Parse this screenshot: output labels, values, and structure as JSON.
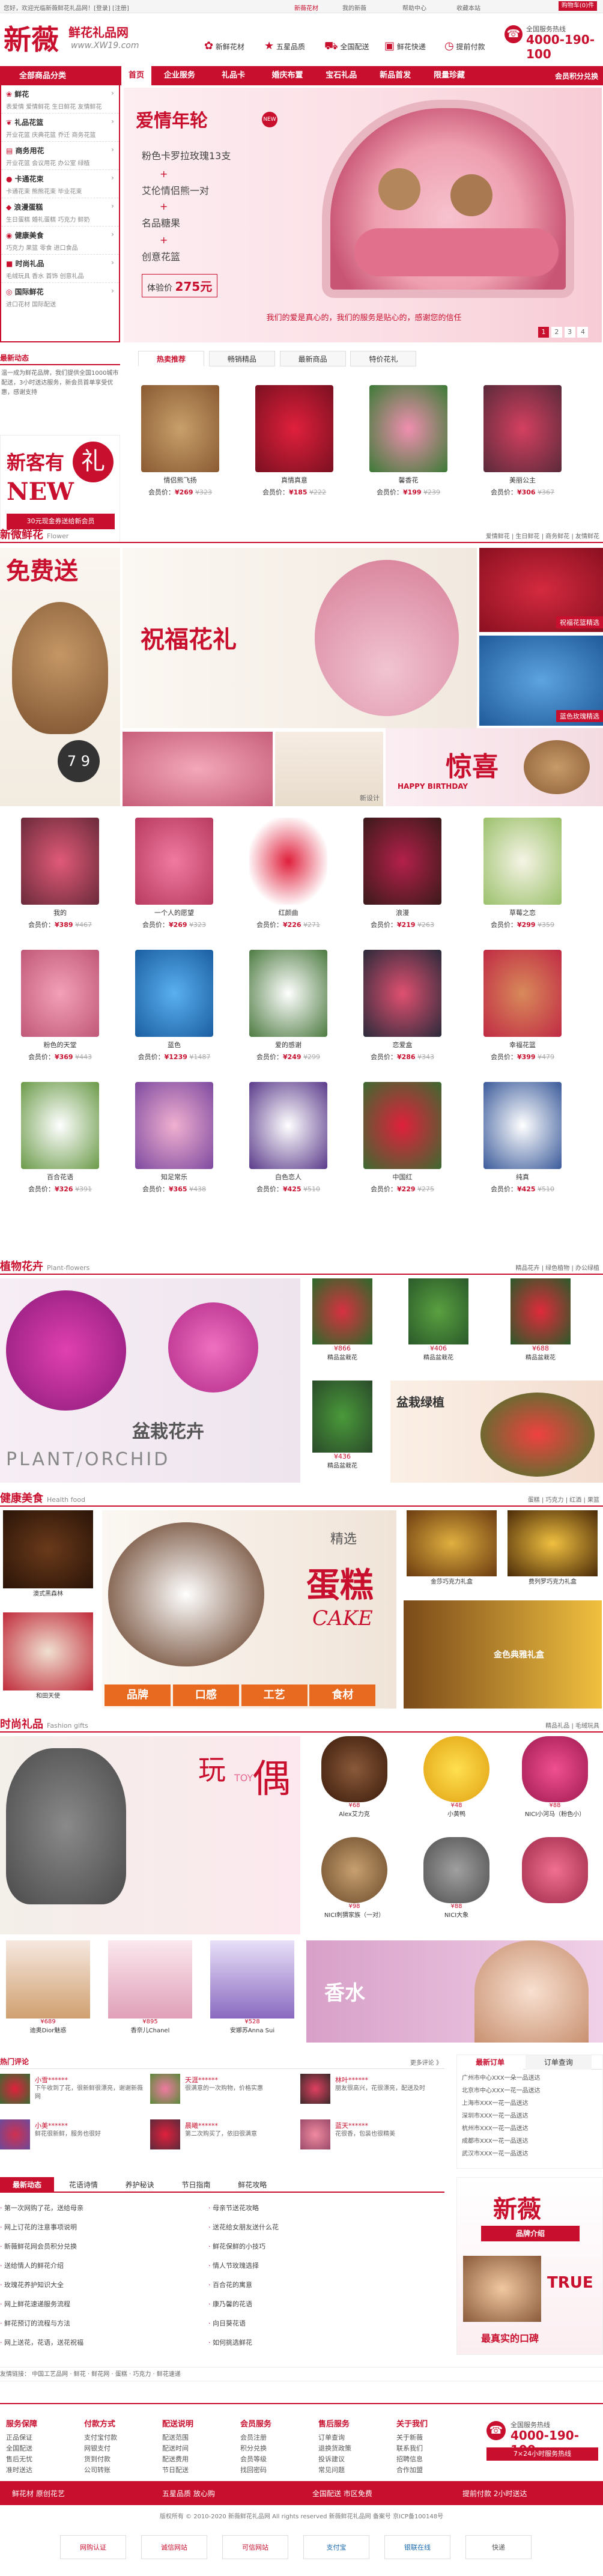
{
  "topbar": {
    "welcome": "您好，欢迎光临新薇鲜花礼品网！[登录] [注册]",
    "links": [
      "新薇花材",
      "我的新薇",
      "帮助中心",
      "收藏本站"
    ]
  },
  "logo": {
    "name": "新薇",
    "cn": "鲜花礼品网",
    "url": "www.XW19.com"
  },
  "header": {
    "promos": [
      "新鲜花材",
      "五星品质",
      "全国配送",
      "鲜花快递",
      "提前付款"
    ],
    "hotline_label": "全国服务热线",
    "hotline": "4000-190-100",
    "cart": "购物车(0)件"
  },
  "nav": {
    "all": "全部商品分类",
    "items": [
      "首页",
      "企业服务",
      "礼品卡",
      "婚庆布置",
      "宝石礼品",
      "新品首发",
      "限量珍藏"
    ],
    "right": "会员积分兑换"
  },
  "categories": [
    {
      "title": "鲜花",
      "sub": "表爱情 爱情鲜花 生日鲜花 友情鲜花"
    },
    {
      "title": "礼品花篮",
      "sub": "开业花篮 庆典花篮 乔迁 商务花篮"
    },
    {
      "title": "商务用花",
      "sub": "开业花篮 会议用花 办公室 绿植"
    },
    {
      "title": "卡通花束",
      "sub": "卡通花束 熊熊花束 毕业花束"
    },
    {
      "title": "浪漫蛋糕",
      "sub": "生日蛋糕 婚礼蛋糕 巧克力 鲜奶"
    },
    {
      "title": "健康美食",
      "sub": "巧克力 果篮 零食 进口食品"
    },
    {
      "title": "时尚礼品",
      "sub": "毛绒玩具 香水 首饰 创意礼品"
    },
    {
      "title": "国际鲜花",
      "sub": "进口花材 国际配送"
    }
  ],
  "banner": {
    "title": "爱情年轮",
    "line1": "粉色卡罗拉玫瑰13支",
    "line2": "艾伦情侣熊一对",
    "line3": "名品糖果",
    "line4": "创意花篮",
    "price_label": "体验价",
    "price": "275元",
    "slogan": "我们的爱是真心的，我们的服务是贴心的，感谢您的信任"
  },
  "news": {
    "title": "最新动态",
    "text": "温一成为鲜花品牌，我们提供全国1000城市配送，3小时送达服务，新会员首单享受优惠，感谢支持",
    "badge_cn": "新客有",
    "badge_en": "NEW",
    "badge_li": "礼",
    "badge_note": "30元现金券送给新会员"
  },
  "hot_tabs": [
    "热卖推荐",
    "畅销精品",
    "最新商品",
    "特价花礼"
  ],
  "hot_products": [
    {
      "name": "情侣熊飞扬",
      "price": "¥269",
      "old": "¥323"
    },
    {
      "name": "真情真意",
      "price": "¥185",
      "old": "¥222"
    },
    {
      "name": "馨香花",
      "price": "¥199",
      "old": "¥239"
    },
    {
      "name": "美丽公主",
      "price": "¥306",
      "old": "¥367"
    }
  ],
  "sec_flower": {
    "title": "新微鲜花",
    "en": "Flower",
    "links": [
      "爱情鲜花",
      "生日鲜花",
      "商务鲜花",
      "友情鲜花"
    ],
    "promo": "免费送",
    "price_tag": "7 9",
    "calligraphy": "祝福花礼",
    "tags": [
      "祝福花篮精选",
      "蓝色玫瑰精选",
      "新设计"
    ],
    "birthday": "惊喜",
    "birthday_en": "HAPPY BIRTHDAY"
  },
  "flower_products": [
    {
      "name": "我的",
      "price": "¥389",
      "old": "¥467"
    },
    {
      "name": "一个人的愿望",
      "price": "¥269",
      "old": "¥323"
    },
    {
      "name": "红颜曲",
      "price": "¥226",
      "old": "¥271"
    },
    {
      "name": "浪漫",
      "price": "¥219",
      "old": "¥263"
    },
    {
      "name": "草莓之恋",
      "price": "¥299",
      "old": "¥359"
    },
    {
      "name": "粉色的天堂",
      "price": "¥369",
      "old": "¥443"
    },
    {
      "name": "蓝色",
      "price": "¥1239",
      "old": "¥1487"
    },
    {
      "name": "爱的感谢",
      "price": "¥249",
      "old": "¥299"
    },
    {
      "name": "恋爱盒",
      "price": "¥286",
      "old": "¥343"
    },
    {
      "name": "幸福花篮",
      "price": "¥399",
      "old": "¥479"
    },
    {
      "name": "百合花语",
      "price": "¥326",
      "old": "¥391"
    },
    {
      "name": "知足常乐",
      "price": "¥365",
      "old": "¥438"
    },
    {
      "name": "白色恋人",
      "price": "¥425",
      "old": "¥510"
    },
    {
      "name": "中国红",
      "price": "¥229",
      "old": "¥275"
    },
    {
      "name": "纯真",
      "price": "¥425",
      "old": "¥510"
    }
  ],
  "sec_plant": {
    "title": "植物花卉",
    "en": "Plant-flowers",
    "links": [
      "精品花卉",
      "绿色植物",
      "办公绿植"
    ],
    "big_cn": "盆栽花卉",
    "big_en": "PLANT/ORCHID",
    "green": "盆栽绿植",
    "items": [
      {
        "price": "¥866",
        "name": "精品盆栽花"
      },
      {
        "price": "¥406",
        "name": "精品盆栽花"
      },
      {
        "price": "¥688",
        "name": "精品盆栽花"
      },
      {
        "price": "¥436",
        "name": "精品盆栽花"
      }
    ]
  },
  "sec_food": {
    "title": "健康美食",
    "en": "Health food",
    "links": [
      "蛋糕",
      "巧克力",
      "红酒",
      "果篮"
    ],
    "cake_cn": "蛋糕",
    "cake_en": "CAKE",
    "jing": "精选",
    "pills": [
      "品牌",
      "口感",
      "工艺",
      "食材"
    ],
    "items": [
      "澳式黑森林",
      "和田天使",
      "金莎巧克力礼盒",
      "费列罗巧克力礼盒",
      "金色典雅礼盒"
    ]
  },
  "sec_gift": {
    "title": "时尚礼品",
    "en": "Fashion gifts",
    "links": [
      "精品礼品",
      "毛绒玩具"
    ],
    "wan": "玩",
    "ou": "偶",
    "toy": "TOY",
    "perfume": "香水",
    "items": [
      {
        "name": "Alex艾力克",
        "price": "¥68"
      },
      {
        "name": "小黄鸭",
        "price": "¥48"
      },
      {
        "name": "NICI小河马（粉色小）",
        "price": "¥88"
      },
      {
        "name": "NICI刺猬家族（一对）",
        "price": "¥98"
      },
      {
        "name": "NICI大象",
        "price": "¥88"
      },
      {
        "name": "迪奥Dior魅惑",
        "price": "¥689"
      },
      {
        "name": "香奈儿Chanel",
        "price": "¥895"
      },
      {
        "name": "安娜苏Anna Sui",
        "price": "¥528"
      }
    ]
  },
  "comments": {
    "title": "热门评论",
    "more": "更多评论 》",
    "rows": [
      [
        "小雪******",
        "下午收到了花，很新鲜很漂亮，谢谢新薇网"
      ],
      [
        "天涯******",
        "很满意的一次购物，价格实惠"
      ],
      [
        "林叶******",
        "朋友很高兴，花很漂亮，配送及时"
      ],
      [
        "小美******",
        "鲜花很新鲜，服务也很好"
      ],
      [
        "晨曦******",
        "第二次购买了，依旧很满意"
      ],
      [
        "蓝天******",
        "花很香，包装也很精美"
      ]
    ]
  },
  "orders": {
    "title": "最新订单",
    "state": "订单查询",
    "rows": [
      "广州市中心XXX一朵一品送达",
      "北京市中心XXX一花一品送达",
      "上海市XXX一花一品送达",
      "深圳市XXX一花一品送达",
      "杭州市XXX一花一品送达",
      "成都市XXX一花一品送达",
      "武汉市XXX一花一品送达"
    ]
  },
  "article_tabs": [
    "最新动态",
    "花语诗情",
    "养护秘诀",
    "节日指南",
    "鲜花攻略"
  ],
  "articles": [
    [
      "第一次网购了花，送给母亲",
      "母亲节送花攻略"
    ],
    [
      "网上订花的注意事项说明",
      "送花给女朋友送什么花"
    ],
    [
      "新薇鲜花网会员积分兑换",
      "鲜花保鲜的小技巧"
    ],
    [
      "送给情人的鲜花介绍",
      "情人节玫瑰选择"
    ],
    [
      "玫瑰花养护知识大全",
      "百合花的寓意"
    ],
    [
      "网上鲜花速递服务流程",
      "康乃馨的花语"
    ],
    [
      "鲜花预订的流程与方法",
      "向日葵花语"
    ],
    [
      "网上送花，花语，送花祝福",
      "如何挑选鲜花"
    ]
  ],
  "brand_box": {
    "name": "新薇",
    "tag": "品牌介绍",
    "line": "TRUE",
    "slogan": "最真实的口碑"
  },
  "friend_links": [
    "友情链接：",
    "中国工艺品网",
    "鲜花",
    "鲜花网",
    "蛋糕",
    "巧克力",
    "鲜花速递"
  ],
  "footer_cols": [
    {
      "h": "服务保障",
      "l": [
        "正品保证",
        "全国配送",
        "售后无忧",
        "准时送达"
      ]
    },
    {
      "h": "付款方式",
      "l": [
        "支付宝付款",
        "网银支付",
        "货到付款",
        "公司转账"
      ]
    },
    {
      "h": "配送说明",
      "l": [
        "配送范围",
        "配送时间",
        "配送费用",
        "节日配送"
      ]
    },
    {
      "h": "会员服务",
      "l": [
        "会员注册",
        "积分兑换",
        "会员等级",
        "找回密码"
      ]
    },
    {
      "h": "售后服务",
      "l": [
        "订单查询",
        "退换货政策",
        "投诉建议",
        "常见问题"
      ]
    },
    {
      "h": "关于我们",
      "l": [
        "关于新薇",
        "联系我们",
        "招聘信息",
        "合作加盟"
      ]
    }
  ],
  "footer_hotline": {
    "label": "全国服务热线",
    "number": "4000-190-100",
    "hours": "7×24小时服务热线"
  },
  "guarantee": [
    "鲜花材 原创花艺",
    "五星品质 放心购",
    "全国配送 市区免费",
    "提前付款 2小时送达"
  ],
  "copyright": "版权所有 © 2010-2020 新薇鲜花礼品网 All rights reserved 新薇鲜花礼品网 备案号 京ICP备100148号",
  "badges": [
    "网购认证",
    "诚信网站",
    "可信网站",
    "支付宝",
    "银联在线",
    "快递"
  ],
  "colors": {
    "primary": "#c8102e",
    "dark": "#8a0e1e"
  }
}
